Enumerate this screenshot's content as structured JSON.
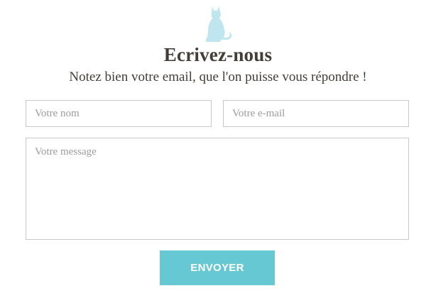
{
  "header": {
    "icon": "cat-icon",
    "title": "Ecrivez-nous",
    "subtitle": "Notez bien votre email, que l'on puisse vous répondre !"
  },
  "form": {
    "name_placeholder": "Votre nom",
    "email_placeholder": "Votre e-mail",
    "message_placeholder": "Votre message",
    "submit_label": "ENVOYER"
  },
  "colors": {
    "accent": "#66c8d3",
    "icon": "#bfe6ee",
    "text": "#433d38",
    "border": "#c9c9c9"
  }
}
